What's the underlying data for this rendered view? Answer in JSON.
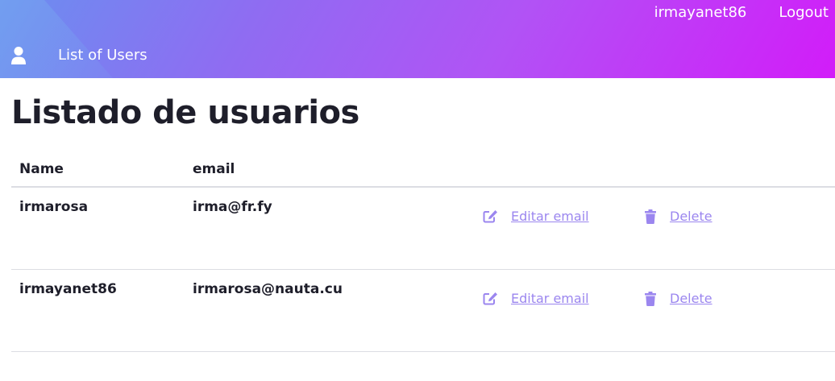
{
  "header": {
    "username": "irmayanet86",
    "logout_label": "Logout",
    "nav_label": "List of Users",
    "icon": "user-icon"
  },
  "main": {
    "title": "Listado de usuarios",
    "columns": [
      "Name",
      "email"
    ],
    "rows": [
      {
        "name": "irmarosa",
        "email": "irma@fr.fy",
        "edit_label": " Editar email",
        "delete_label": " Delete"
      },
      {
        "name": "irmayanet86",
        "email": "irmarosa@nauta.cu",
        "edit_label": " Editar email",
        "delete_label": " Delete"
      }
    ]
  },
  "colors": {
    "accent": "#9b86ef",
    "gradient_start": "#6a8ff0",
    "gradient_end": "#d21cf9"
  }
}
